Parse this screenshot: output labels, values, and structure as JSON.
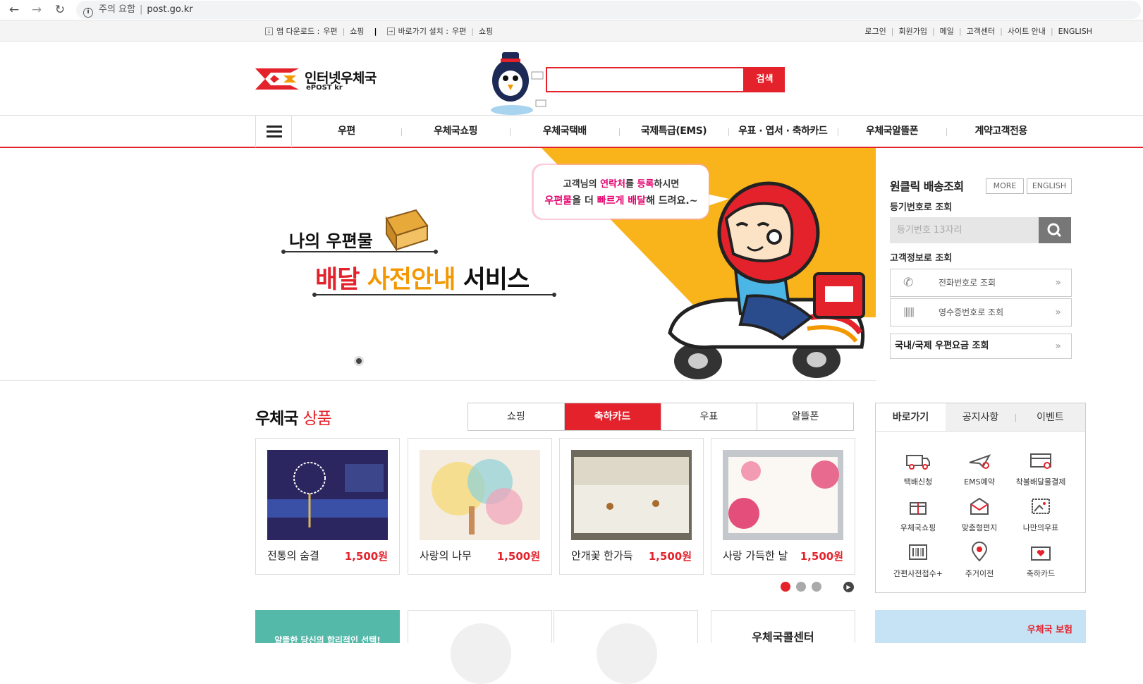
{
  "browser": {
    "back_icon": "arrow-left",
    "forward_icon": "arrow-right",
    "reload_icon": "reload",
    "security_label": "주의 요함",
    "url": "post.go.kr"
  },
  "util": {
    "app_download_label": "앱 다운로드 :",
    "app_links": [
      "우편",
      "쇼핑"
    ],
    "shortcut_label": "바로가기 설치 :",
    "shortcut_links": [
      "우편",
      "쇼핑"
    ],
    "right_links": [
      "로그인",
      "회원가입",
      "메일",
      "고객센터",
      "사이트 안내",
      "ENGLISH"
    ]
  },
  "header": {
    "logo_name": "인터넷우체국",
    "logo_sub": "ePOST kr",
    "search_placeholder": "",
    "search_button": "검색"
  },
  "gnb": {
    "items": [
      "우편",
      "우체국쇼핑",
      "우체국택배",
      "국제특급(EMS)",
      "우표 · 엽서 · 축하카드",
      "우체국알뜰폰",
      "계약고객전용"
    ]
  },
  "banner": {
    "title1": "나의 우편물",
    "title2_parts": [
      "배달 ",
      "사전안내",
      " 서비스"
    ],
    "bubble_line1_parts": [
      "고객님의 ",
      "연락처",
      "를 ",
      "등록",
      "하시면"
    ],
    "bubble_line2_parts": [
      "우편물",
      "을 더 ",
      "빠르게 배달",
      "해 드려요.~"
    ],
    "colors": {
      "yellow": "#f9b31b",
      "red": "#e4222b",
      "orange": "#f39800"
    }
  },
  "tracking": {
    "title": "원클릭 배송조회",
    "more_button": "MORE",
    "english_button": "ENGLISH",
    "reg_label": "등기번호로 조회",
    "reg_placeholder": "등기번호 13자리",
    "customer_label": "고객정보로 조회",
    "rows": [
      "전화번호로 조회",
      "영수증번호로 조회"
    ],
    "rate_row": "국내/국제 우편요금 조회"
  },
  "products": {
    "title_black": "우체국",
    "title_red": "상품",
    "tabs": [
      "쇼핑",
      "축하카드",
      "우표",
      "알뜰폰"
    ],
    "active_tab": "축하카드",
    "cards": [
      {
        "name": "전통의 숨결",
        "price": "1,500원"
      },
      {
        "name": "사랑의 나무",
        "price": "1,500원"
      },
      {
        "name": "안개꽃 한가득",
        "price": "1,500원"
      },
      {
        "name": "사랑 가득한 날",
        "price": "1,500원"
      }
    ]
  },
  "quick": {
    "tabs": [
      "바로가기",
      "공지사항",
      "이벤트"
    ],
    "items": [
      {
        "label": "택배신청",
        "icon": "truck-icon"
      },
      {
        "label": "EMS예약",
        "icon": "plane-icon"
      },
      {
        "label": "착불배달물결제",
        "icon": "card-icon"
      },
      {
        "label": "우체국쇼핑",
        "icon": "gift-icon"
      },
      {
        "label": "맞춤형편지",
        "icon": "letter-icon"
      },
      {
        "label": "나만의우표",
        "icon": "stamp-icon"
      },
      {
        "label": "간편사전접수+",
        "icon": "barcode-icon"
      },
      {
        "label": "주거이전",
        "icon": "location-icon"
      },
      {
        "label": "축하카드",
        "icon": "greeting-card-icon"
      }
    ]
  },
  "bottom": {
    "promo_text": "알뜰한 당신의 합리적인 선택!",
    "callcenter": "우체국콜센터",
    "insurance_text": "우체국 보험"
  }
}
